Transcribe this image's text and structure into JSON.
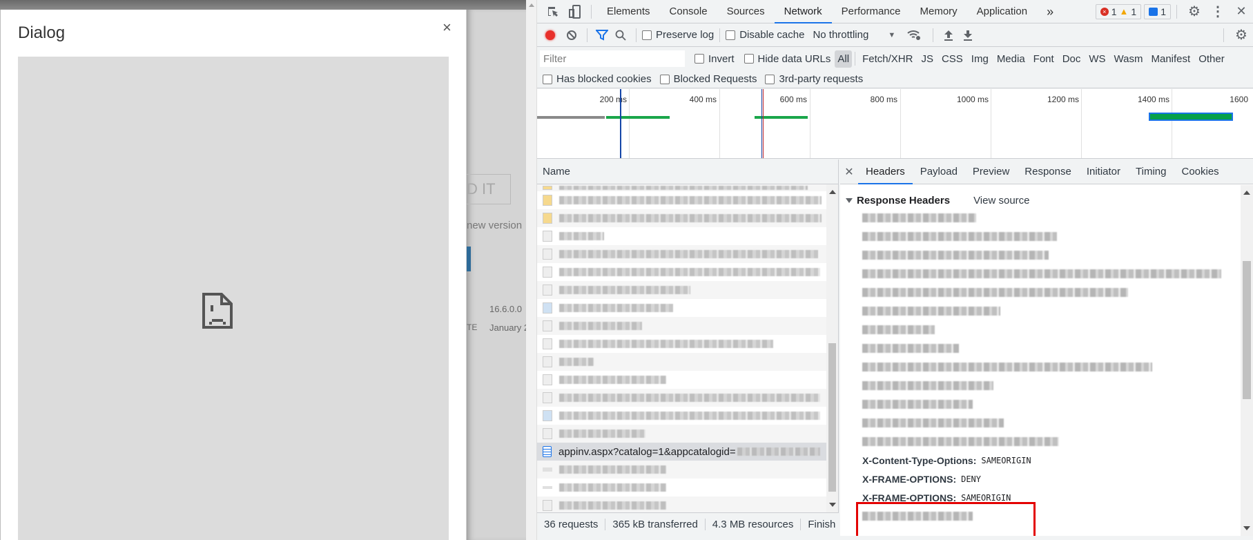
{
  "page": {
    "background_button": "D IT",
    "background_new_version": "new version",
    "background_version": "16.6.0.0",
    "background_label_fragment": "TE",
    "background_date_fragment": "January 2"
  },
  "dialog": {
    "title": "Dialog",
    "close_label": "×",
    "frame_state": "sad-page-icon"
  },
  "devtools": {
    "tabs": [
      "Elements",
      "Console",
      "Sources",
      "Network",
      "Performance",
      "Memory",
      "Application"
    ],
    "active_tab": "Network",
    "more_tabs": "»",
    "errors": "1",
    "warnings": "1",
    "messages": "1",
    "close_label": "✕",
    "toolbar": {
      "preserve_log": "Preserve log",
      "disable_cache": "Disable cache",
      "throttling": "No throttling"
    },
    "filter": {
      "placeholder": "Filter",
      "invert": "Invert",
      "hide_data_urls": "Hide data URLs",
      "types": [
        "All",
        "Fetch/XHR",
        "JS",
        "CSS",
        "Img",
        "Media",
        "Font",
        "Doc",
        "WS",
        "Wasm",
        "Manifest",
        "Other"
      ],
      "selected_type": "All",
      "has_blocked_cookies": "Has blocked cookies",
      "blocked_requests": "Blocked Requests",
      "third_party": "3rd-party requests"
    },
    "timeline": {
      "ticks": [
        "200 ms",
        "400 ms",
        "600 ms",
        "800 ms",
        "1000 ms",
        "1200 ms",
        "1400 ms",
        "1600"
      ]
    },
    "request_list": {
      "column_name": "Name",
      "selected_request": "appinv.aspx?catalog=1&appcatalogid=",
      "blurred_row_count": 17
    },
    "status": {
      "requests": "36 requests",
      "transferred": "365 kB transferred",
      "resources": "4.3 MB resources",
      "finish": "Finish"
    },
    "details": {
      "tabs": [
        "Headers",
        "Payload",
        "Preview",
        "Response",
        "Initiator",
        "Timing",
        "Cookies"
      ],
      "active_tab": "Headers",
      "section_title": "Response Headers",
      "view_source": "View source",
      "visible_headers": [
        {
          "name": "X-Content-Type-Options:",
          "value": "SAMEORIGIN"
        },
        {
          "name": "X-FRAME-OPTIONS:",
          "value": "DENY"
        },
        {
          "name": "X-FRAME-OPTIONS:",
          "value": "SAMEORIGIN"
        }
      ]
    }
  }
}
